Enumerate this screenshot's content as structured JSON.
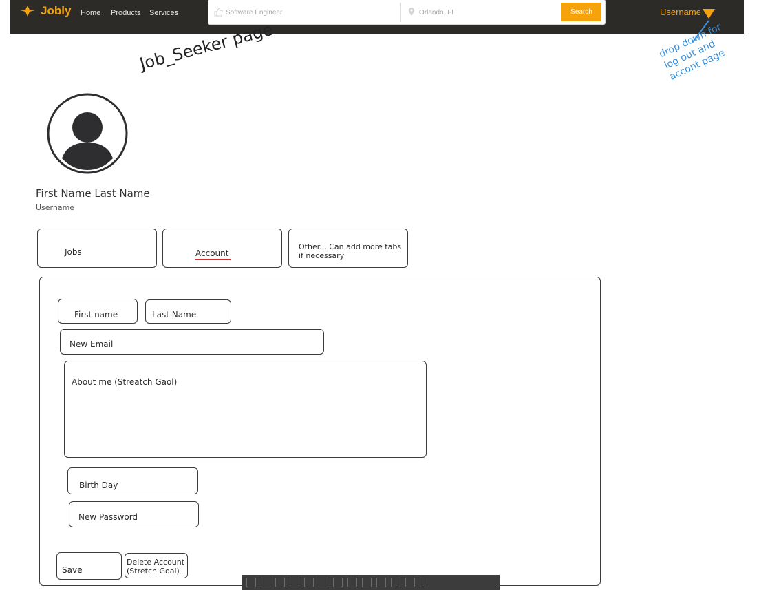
{
  "navbar": {
    "brand": "Jobly",
    "links": [
      "Home",
      "Products",
      "Services"
    ],
    "search": {
      "keyword_placeholder": "Software Engineer",
      "location_placeholder": "Orlando, FL",
      "button_label": "Search"
    },
    "user_menu_label": "Username",
    "colors": {
      "bar": "#2c2b28",
      "accent": "#f4a20f"
    }
  },
  "annotations": {
    "page_note": "Job_Seeker page",
    "dropdown_note": "drop down for log out and accont page"
  },
  "profile": {
    "full_name": "First Name Last Name",
    "username": "Username"
  },
  "tabs": [
    {
      "label": "Jobs"
    },
    {
      "label": "Account"
    },
    {
      "label_line1": "Other... Can add more tabs",
      "label_line2": "if necessary"
    }
  ],
  "account_form": {
    "first_name": "First name",
    "last_name": "Last Name",
    "new_email": "New Email",
    "about_me": "About me (Streatch Gaol)",
    "birth_day": "Birth Day",
    "new_password": "New Password",
    "save_label": "Save",
    "delete_line1": "Delete Account",
    "delete_line2": "(Stretch Goal)"
  },
  "icons": [
    "logo-icon",
    "thumb-icon",
    "location-pin-icon",
    "caret-down-icon",
    "avatar-icon"
  ]
}
